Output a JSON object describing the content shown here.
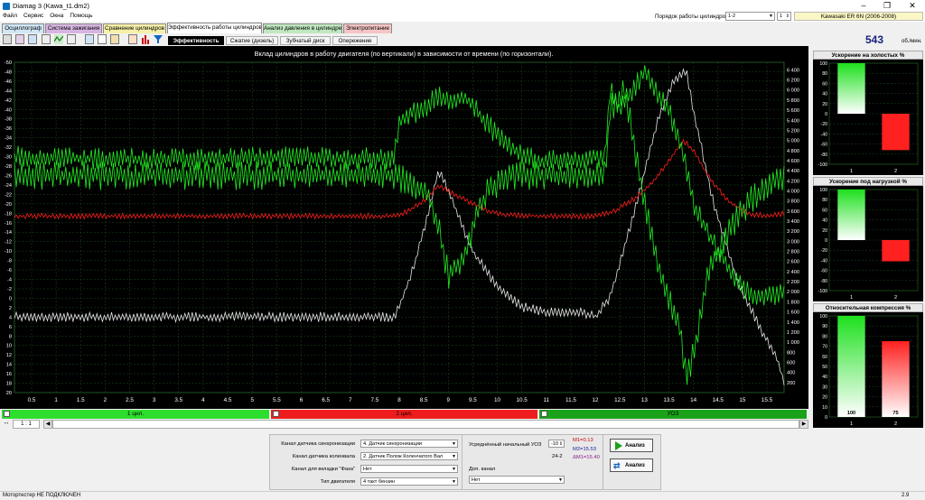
{
  "app": {
    "title": "Diamag 3 (Kawa_t1.dm2)"
  },
  "menu": [
    "Файл",
    "Сервис",
    "Окна",
    "Помощь"
  ],
  "header": {
    "firing_order_label": "Порядок работы цилиндров",
    "firing_order_value": "1-2",
    "cylinder_value": "1",
    "vehicle": "Kawasaki ER 6N (2006-2008)"
  },
  "main_tabs": [
    {
      "label": "Осциллограф",
      "color": "#cfe6f5"
    },
    {
      "label": "Система зажигания",
      "color": "#d8b4e2"
    },
    {
      "label": "Сравнение цилиндров",
      "color": "#f6f0a8"
    },
    {
      "label": "Эффективность работы цилиндров",
      "color": "#ffffff",
      "active": true
    },
    {
      "label": "Анализ давления в цилиндре",
      "color": "#bfe8bf"
    },
    {
      "label": "Электропитание",
      "color": "#f5c4c4"
    }
  ],
  "sub_tabs": [
    "Эффективность",
    "Сжатие (дизель)",
    "Зубчатый диск",
    "Опережение"
  ],
  "rpm": {
    "value": "543",
    "unit": "об./мин."
  },
  "chart_data": {
    "type": "line",
    "title": "Вклад цилиндров в работу двигателя (по вертикали) в зависимости от времени (по горизонтали).",
    "x_ticks": [
      "0.5",
      "1",
      "1.5",
      "2",
      "2.5",
      "3",
      "3.5",
      "4",
      "4.5",
      "5",
      "5.5",
      "6",
      "6.5",
      "7",
      "7.5",
      "8",
      "8.5",
      "9",
      "9.5",
      "10",
      "10.5",
      "11",
      "11.5",
      "12",
      "12.5",
      "13",
      "13.5",
      "14",
      "14.5",
      "15",
      "15.5"
    ],
    "left_ticks": [
      "-50",
      "-48",
      "-46",
      "-44",
      "-42",
      "-40",
      "-38",
      "-36",
      "-34",
      "-32",
      "-30",
      "-28",
      "-26",
      "-24",
      "-22",
      "-20",
      "-18",
      "-16",
      "-14",
      "-12",
      "-10",
      "-8",
      "-6",
      "-4",
      "-2",
      "0",
      "2",
      "4",
      "6",
      "8",
      "10",
      "12",
      "14",
      "16",
      "18",
      "20"
    ],
    "right_ticks": [
      "6 400",
      "6 200",
      "6 000",
      "5 800",
      "5 600",
      "5 400",
      "5 200",
      "5 000",
      "4 800",
      "4 600",
      "4 400",
      "4 200",
      "4 000",
      "3 800",
      "3 600",
      "3 400",
      "3 200",
      "3 000",
      "2 800",
      "2 600",
      "2 400",
      "2 200",
      "2 000",
      "1 800",
      "1 600",
      "1 400",
      "1 200",
      "1 000",
      "800",
      "600",
      "400",
      "200"
    ],
    "xlim": [
      0.15,
      15.85
    ],
    "ylim_left": [
      -50,
      20
    ],
    "ylim_right": [
      0,
      6550
    ],
    "series": [
      {
        "color": "#e6e6e6",
        "axis": "right",
        "noise": 70,
        "points": [
          [
            0.15,
            1500
          ],
          [
            7.9,
            1500
          ],
          [
            8.0,
            1700
          ],
          [
            8.3,
            2500
          ],
          [
            8.6,
            3600
          ],
          [
            8.8,
            4400
          ],
          [
            9.0,
            4000
          ],
          [
            9.5,
            2800
          ],
          [
            10.0,
            2100
          ],
          [
            10.5,
            1700
          ],
          [
            11.0,
            1600
          ],
          [
            11.7,
            1600
          ],
          [
            12.0,
            1500
          ],
          [
            12.3,
            1900
          ],
          [
            12.8,
            3600
          ],
          [
            13.3,
            5500
          ],
          [
            13.6,
            6200
          ],
          [
            13.85,
            6400
          ],
          [
            14.0,
            5600
          ],
          [
            14.4,
            3800
          ],
          [
            14.9,
            2200
          ],
          [
            15.4,
            1200
          ],
          [
            15.7,
            700
          ],
          [
            15.85,
            200
          ]
        ]
      },
      {
        "color": "#ff1e1e",
        "axis": "right",
        "noise": 40,
        "points": [
          [
            0.15,
            3500
          ],
          [
            7.9,
            3500
          ],
          [
            8.2,
            3600
          ],
          [
            8.5,
            3800
          ],
          [
            8.8,
            4100
          ],
          [
            9.0,
            4000
          ],
          [
            9.3,
            3850
          ],
          [
            9.8,
            3600
          ],
          [
            10.2,
            3520
          ],
          [
            11.0,
            3500
          ],
          [
            12.0,
            3500
          ],
          [
            12.4,
            3600
          ],
          [
            12.8,
            3850
          ],
          [
            13.2,
            4200
          ],
          [
            13.5,
            4600
          ],
          [
            13.8,
            5000
          ],
          [
            14.0,
            4800
          ],
          [
            14.3,
            4300
          ],
          [
            14.7,
            3800
          ],
          [
            15.1,
            3550
          ],
          [
            15.5,
            3500
          ],
          [
            15.85,
            3550
          ]
        ]
      },
      {
        "color": "#22ee22",
        "axis": "left",
        "noise": 1.7,
        "points": [
          [
            0.15,
            -30
          ],
          [
            2.0,
            -29.5
          ],
          [
            4.0,
            -29.5
          ],
          [
            6.0,
            -30
          ],
          [
            7.9,
            -29.5
          ],
          [
            8.0,
            -38
          ],
          [
            8.5,
            -40
          ],
          [
            8.8,
            -43
          ],
          [
            9.1,
            -42
          ],
          [
            9.4,
            -42
          ],
          [
            9.8,
            -37
          ],
          [
            10.2,
            -32
          ],
          [
            10.8,
            -29
          ],
          [
            11.5,
            -29.5
          ],
          [
            12.2,
            -30
          ],
          [
            12.3,
            -44
          ],
          [
            12.5,
            -40
          ],
          [
            13.0,
            -48
          ],
          [
            13.5,
            -40
          ],
          [
            13.8,
            -30
          ],
          [
            14.0,
            -20
          ],
          [
            14.5,
            -10
          ],
          [
            14.9,
            -3
          ],
          [
            15.4,
            0
          ],
          [
            15.85,
            -1
          ]
        ]
      },
      {
        "color": "#22ee22",
        "axis": "left",
        "noise": 2.2,
        "points": [
          [
            0.15,
            -26
          ],
          [
            7.9,
            -26
          ],
          [
            8.3,
            -24
          ],
          [
            8.6,
            -22
          ],
          [
            8.8,
            -15
          ],
          [
            9.0,
            -5
          ],
          [
            9.3,
            -8
          ],
          [
            9.6,
            -18
          ],
          [
            9.8,
            -23
          ],
          [
            10.3,
            -26
          ],
          [
            12.2,
            -26
          ],
          [
            12.3,
            -40
          ],
          [
            12.6,
            -44
          ],
          [
            13.0,
            -20
          ],
          [
            13.4,
            -2
          ],
          [
            13.7,
            5
          ],
          [
            13.85,
            17
          ],
          [
            14.0,
            12
          ],
          [
            14.3,
            -5
          ],
          [
            14.7,
            -14
          ],
          [
            15.1,
            -20
          ],
          [
            15.5,
            -24
          ],
          [
            15.85,
            -26
          ]
        ]
      }
    ]
  },
  "channels": [
    {
      "label": "1 цил.",
      "color": "#2ede2e"
    },
    {
      "label": "2 цил.",
      "color": "#ee1c1c"
    },
    {
      "label": "УОЗ",
      "color": "#1aa31a"
    }
  ],
  "zoom_label": "1 : 1",
  "bottom_panel": {
    "rows": [
      {
        "label": "Канал датчика синхронизации",
        "value": "4.  Датчик синхронизации"
      },
      {
        "label": "Канал датчика коленвала",
        "value": "2.  Датчик Полож Коленчатого Вал"
      },
      {
        "label": "Канал для вкладки \"Фаза\"",
        "value": "Нет"
      },
      {
        "label": "Тип двигателя",
        "value": "4 такт бензин"
      }
    ],
    "avg_label": "Усреднённый начальный УОЗ",
    "avg_value": "-10",
    "code": "24-2",
    "m1": "M1=0.13",
    "m2": "M2=15.53",
    "dm": "ΔM1=15.40",
    "dop_label": "Доп. канал",
    "dop_value": "Нет",
    "btn1": "Анализ",
    "btn2": "Анализ"
  },
  "right_panels": [
    {
      "title": "Ускорение на холостых %",
      "ticks": [
        "100",
        "80",
        "60",
        "40",
        "20",
        "0",
        "-20",
        "-40",
        "-60",
        "-80",
        "-100"
      ],
      "range": [
        -100,
        100
      ],
      "bars": [
        {
          "cat": "1",
          "value": 100,
          "color": "#1ee01e"
        },
        {
          "cat": "2",
          "value": -72,
          "color": "#ff2020"
        }
      ]
    },
    {
      "title": "Ускорение под нагрузкой %",
      "ticks": [
        "100",
        "80",
        "60",
        "40",
        "20",
        "0",
        "-20",
        "-40",
        "-60",
        "-80",
        "-100"
      ],
      "range": [
        -100,
        100
      ],
      "bars": [
        {
          "cat": "1",
          "value": 100,
          "color": "#1ee01e"
        },
        {
          "cat": "2",
          "value": -42,
          "color": "#ff2020"
        }
      ]
    },
    {
      "title": "Относительная компрессия %",
      "ticks": [
        "100",
        "90",
        "80",
        "70",
        "60",
        "50",
        "40",
        "30",
        "20",
        "10",
        "0"
      ],
      "range": [
        0,
        100
      ],
      "bars": [
        {
          "cat": "1",
          "value": 100,
          "color": "#1ee01e",
          "label": "100"
        },
        {
          "cat": "2",
          "value": 75,
          "color": "#ff2020",
          "label": "75"
        }
      ]
    }
  ],
  "status": {
    "text": "Мотортестер НЕ ПОДКЛЮЧЕН",
    "version": "2.9"
  }
}
